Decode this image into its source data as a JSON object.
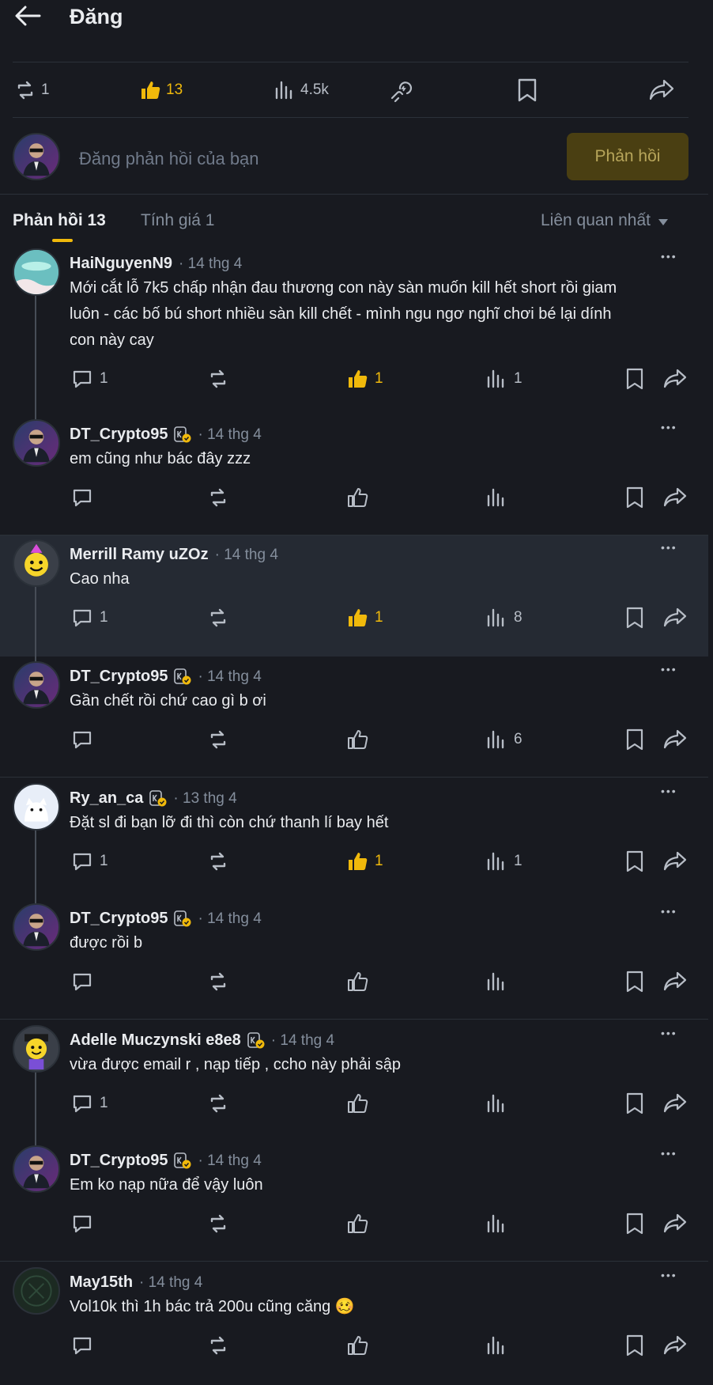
{
  "header": {
    "title": "Đăng"
  },
  "stats": {
    "reposts": "1",
    "likes": "13",
    "views": "4.5k"
  },
  "reply_box": {
    "placeholder": "Đăng phản hồi của bạn",
    "button": "Phản hồi"
  },
  "tabs": {
    "replies": "Phản hồi 13",
    "ratings": "Tính giá 1",
    "sort": "Liên quan nhất"
  },
  "colors": {
    "accent": "#f0b90b",
    "bg": "#181a20",
    "divider": "#2b3139",
    "text": "#eaecef",
    "muted": "#848e9c"
  },
  "comments": [
    {
      "name": "HaiNguyenN9",
      "date": "· 14 thg 4",
      "badge": false,
      "text": [
        "Mới cắt lỗ 7k5 chấp nhận đau thương con này sàn muốn kill hết short rồi giam",
        "luôn - các bố bú short nhiều sàn kill chết - mình ngu ngơ nghĩ chơi bé lại dính",
        "con này cay"
      ],
      "replies": "1",
      "likes": "1",
      "views": "1",
      "liked": true
    },
    {
      "name": "DT_Crypto95",
      "date": "· 14 thg 4",
      "badge": true,
      "text": [
        "em cũng như bác đây zzz"
      ],
      "replies": "",
      "likes": "",
      "views": "",
      "liked": false
    },
    {
      "name": "Merrill Ramy uZOz",
      "date": "· 14 thg 4",
      "badge": false,
      "text": [
        "Cao nha"
      ],
      "replies": "1",
      "likes": "1",
      "views": "8",
      "liked": true
    },
    {
      "name": "DT_Crypto95",
      "date": "· 14 thg 4",
      "badge": true,
      "text": [
        "Gần chết rồi chứ cao gì b ơi"
      ],
      "replies": "",
      "likes": "",
      "views": "6",
      "liked": false
    },
    {
      "name": "Ry_an_ca",
      "date": "· 13 thg 4",
      "badge": true,
      "text": [
        "Đặt sl đi bạn lỡ đi thì còn chứ thanh lí bay hết"
      ],
      "replies": "1",
      "likes": "1",
      "views": "1",
      "liked": true
    },
    {
      "name": "DT_Crypto95",
      "date": "· 14 thg 4",
      "badge": true,
      "text": [
        "được rồi b"
      ],
      "replies": "",
      "likes": "",
      "views": "",
      "liked": false
    },
    {
      "name": "Adelle Muczynski e8e8",
      "date": "· 14 thg 4",
      "badge": true,
      "text": [
        "vừa được email r , nạp tiếp , ccho này phải sập"
      ],
      "replies": "1",
      "likes": "",
      "views": "",
      "liked": false
    },
    {
      "name": "DT_Crypto95",
      "date": "· 14 thg 4",
      "badge": true,
      "text": [
        "Em ko nạp nữa để vậy luôn"
      ],
      "replies": "",
      "likes": "",
      "views": "",
      "liked": false
    },
    {
      "name": "May15th",
      "date": "· 14 thg 4",
      "badge": false,
      "text": [
        "Vol10k thì 1h bác trả 200u cũng căng 🥴"
      ],
      "replies": "",
      "likes": "",
      "views": "",
      "liked": false
    }
  ]
}
